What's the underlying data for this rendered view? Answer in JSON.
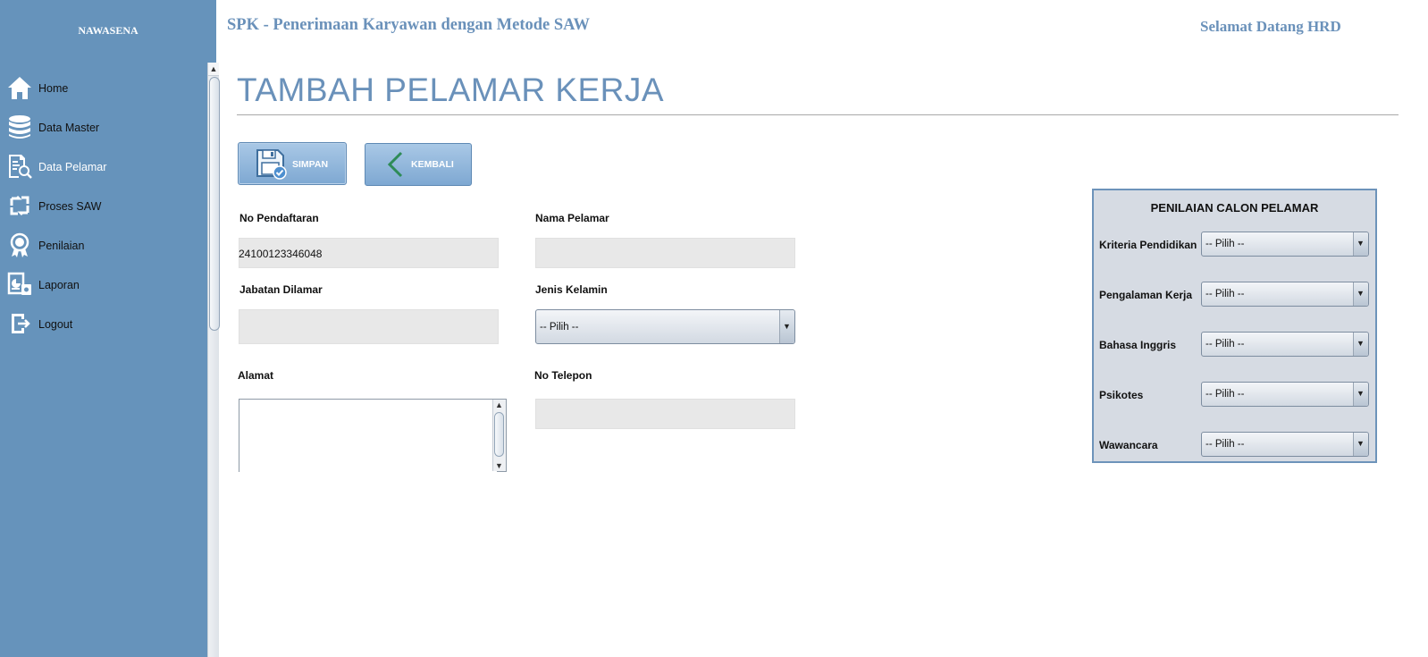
{
  "brand": "NAWASENA",
  "app_title": "SPK -  Penerimaan Karyawan dengan Metode SAW",
  "welcome": "Selamat Datang HRD",
  "sidebar": {
    "items": [
      {
        "label": "Home",
        "icon": "home-icon"
      },
      {
        "label": "Data Master",
        "icon": "database-icon"
      },
      {
        "label": "Data Pelamar",
        "icon": "applicant-search-icon",
        "active": true
      },
      {
        "label": "Proses SAW",
        "icon": "process-icon"
      },
      {
        "label": "Penilaian",
        "icon": "award-icon"
      },
      {
        "label": "Laporan",
        "icon": "report-icon"
      },
      {
        "label": "Logout",
        "icon": "logout-icon"
      }
    ]
  },
  "page_title": "TAMBAH PELAMAR KERJA",
  "buttons": {
    "save": "SIMPAN",
    "back": "KEMBALI"
  },
  "form": {
    "no_pendaftaran": {
      "label": "No Pendaftaran",
      "value": "24100123346048"
    },
    "nama_pelamar": {
      "label": "Nama Pelamar",
      "value": ""
    },
    "jabatan_dilamar": {
      "label": "Jabatan Dilamar",
      "value": ""
    },
    "jenis_kelamin": {
      "label": "Jenis Kelamin",
      "value": "-- Pilih --"
    },
    "alamat": {
      "label": "Alamat",
      "value": ""
    },
    "no_telepon": {
      "label": "No Telepon",
      "value": ""
    }
  },
  "assessment": {
    "title": "PENILAIAN CALON PELAMAR",
    "criteria": [
      {
        "label": "Kriteria Pendidikan",
        "value": "-- Pilih --"
      },
      {
        "label": "Pengalaman Kerja",
        "value": "-- Pilih --"
      },
      {
        "label": "Bahasa Inggris",
        "value": "-- Pilih --"
      },
      {
        "label": "Psikotes",
        "value": "-- Pilih --"
      },
      {
        "label": "Wawancara",
        "value": "-- Pilih --"
      }
    ]
  },
  "colors": {
    "sidebar": "#6693bb",
    "accent": "#6a91ba",
    "panel": "#d6dbe3"
  }
}
